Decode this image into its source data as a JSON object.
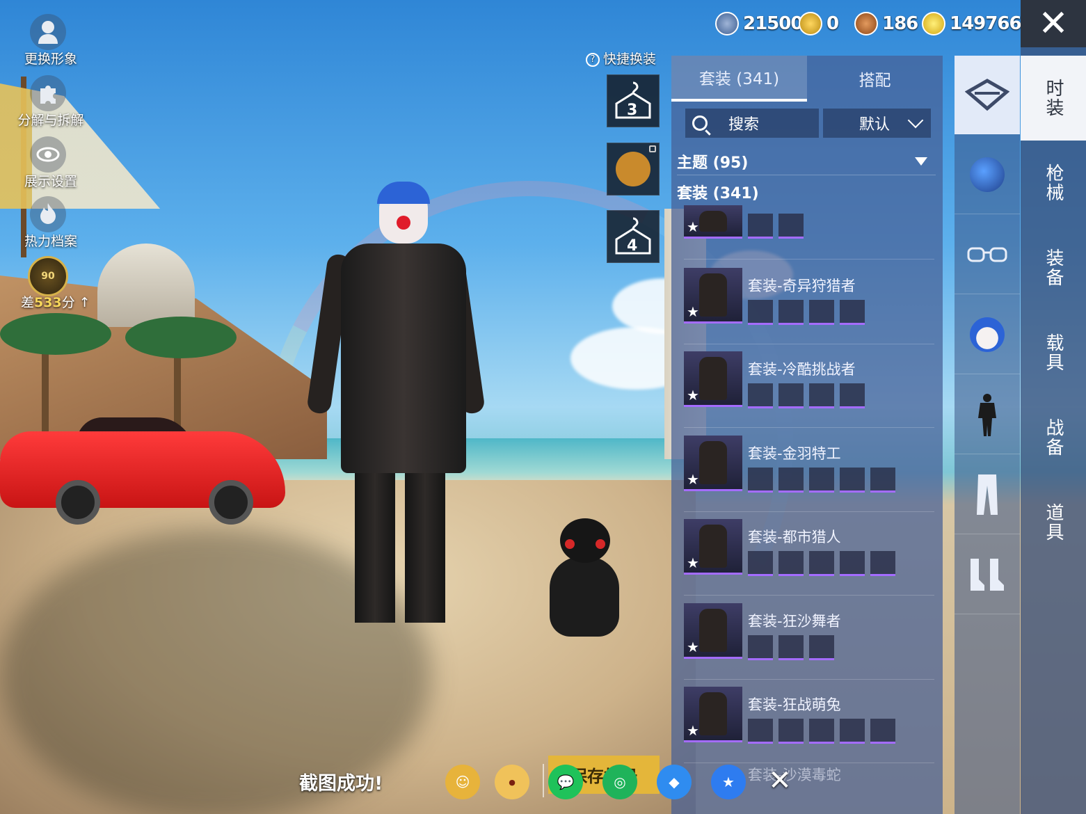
{
  "currency": [
    {
      "icon": "silver-coin-icon",
      "value": "21500"
    },
    {
      "icon": "gold-token-icon",
      "value": "0"
    },
    {
      "icon": "bronze-coin-icon",
      "value": "186"
    },
    {
      "icon": "lightning-coin-icon",
      "value": "149766"
    }
  ],
  "left_menu": [
    {
      "label": "更换形象",
      "icon": "avatar-icon"
    },
    {
      "label": "分解与拆解",
      "icon": "puzzle-icon"
    },
    {
      "label": "展示设置",
      "icon": "eye-icon"
    },
    {
      "label": "热力档案",
      "icon": "flame-icon"
    }
  ],
  "rank": {
    "level": "90",
    "prefix": "差",
    "points": "533",
    "suffix": "分"
  },
  "quick_change": {
    "label": "快捷换装",
    "slots": [
      "3",
      "",
      "4"
    ]
  },
  "panel": {
    "tabs": [
      "套装 (341)",
      "搭配"
    ],
    "search_label": "搜索",
    "sort_label": "默认",
    "theme_label": "主题 (95)",
    "set_count_label": "套装 (341)",
    "sets": [
      {
        "title": "",
        "pieces": 2
      },
      {
        "title": "套装-奇异狩猎者",
        "pieces": 4
      },
      {
        "title": "套装-冷酷挑战者",
        "pieces": 4
      },
      {
        "title": "套装-金羽特工",
        "pieces": 5
      },
      {
        "title": "套装-都市猎人",
        "pieces": 5
      },
      {
        "title": "套装-狂沙舞者",
        "pieces": 3
      },
      {
        "title": "套装-狂战萌兔",
        "pieces": 5
      }
    ],
    "partial_row_title": "套装-沙漠毒蛇"
  },
  "categories": [
    "suit-icon",
    "helmet-icon",
    "glasses-icon",
    "mask-icon",
    "full-body-icon",
    "pants-icon",
    "boots-icon"
  ],
  "main_tabs": [
    "时装",
    "枪械",
    "装备",
    "载具",
    "战备",
    "道具"
  ],
  "bottom_bar": {
    "screenshot_text": "截图成功!",
    "save_label": "保存相册"
  },
  "colors": {
    "accent_gold": "#e4b63a",
    "rarity_purple": "#a46cff",
    "panel_blue": "#465f96"
  }
}
